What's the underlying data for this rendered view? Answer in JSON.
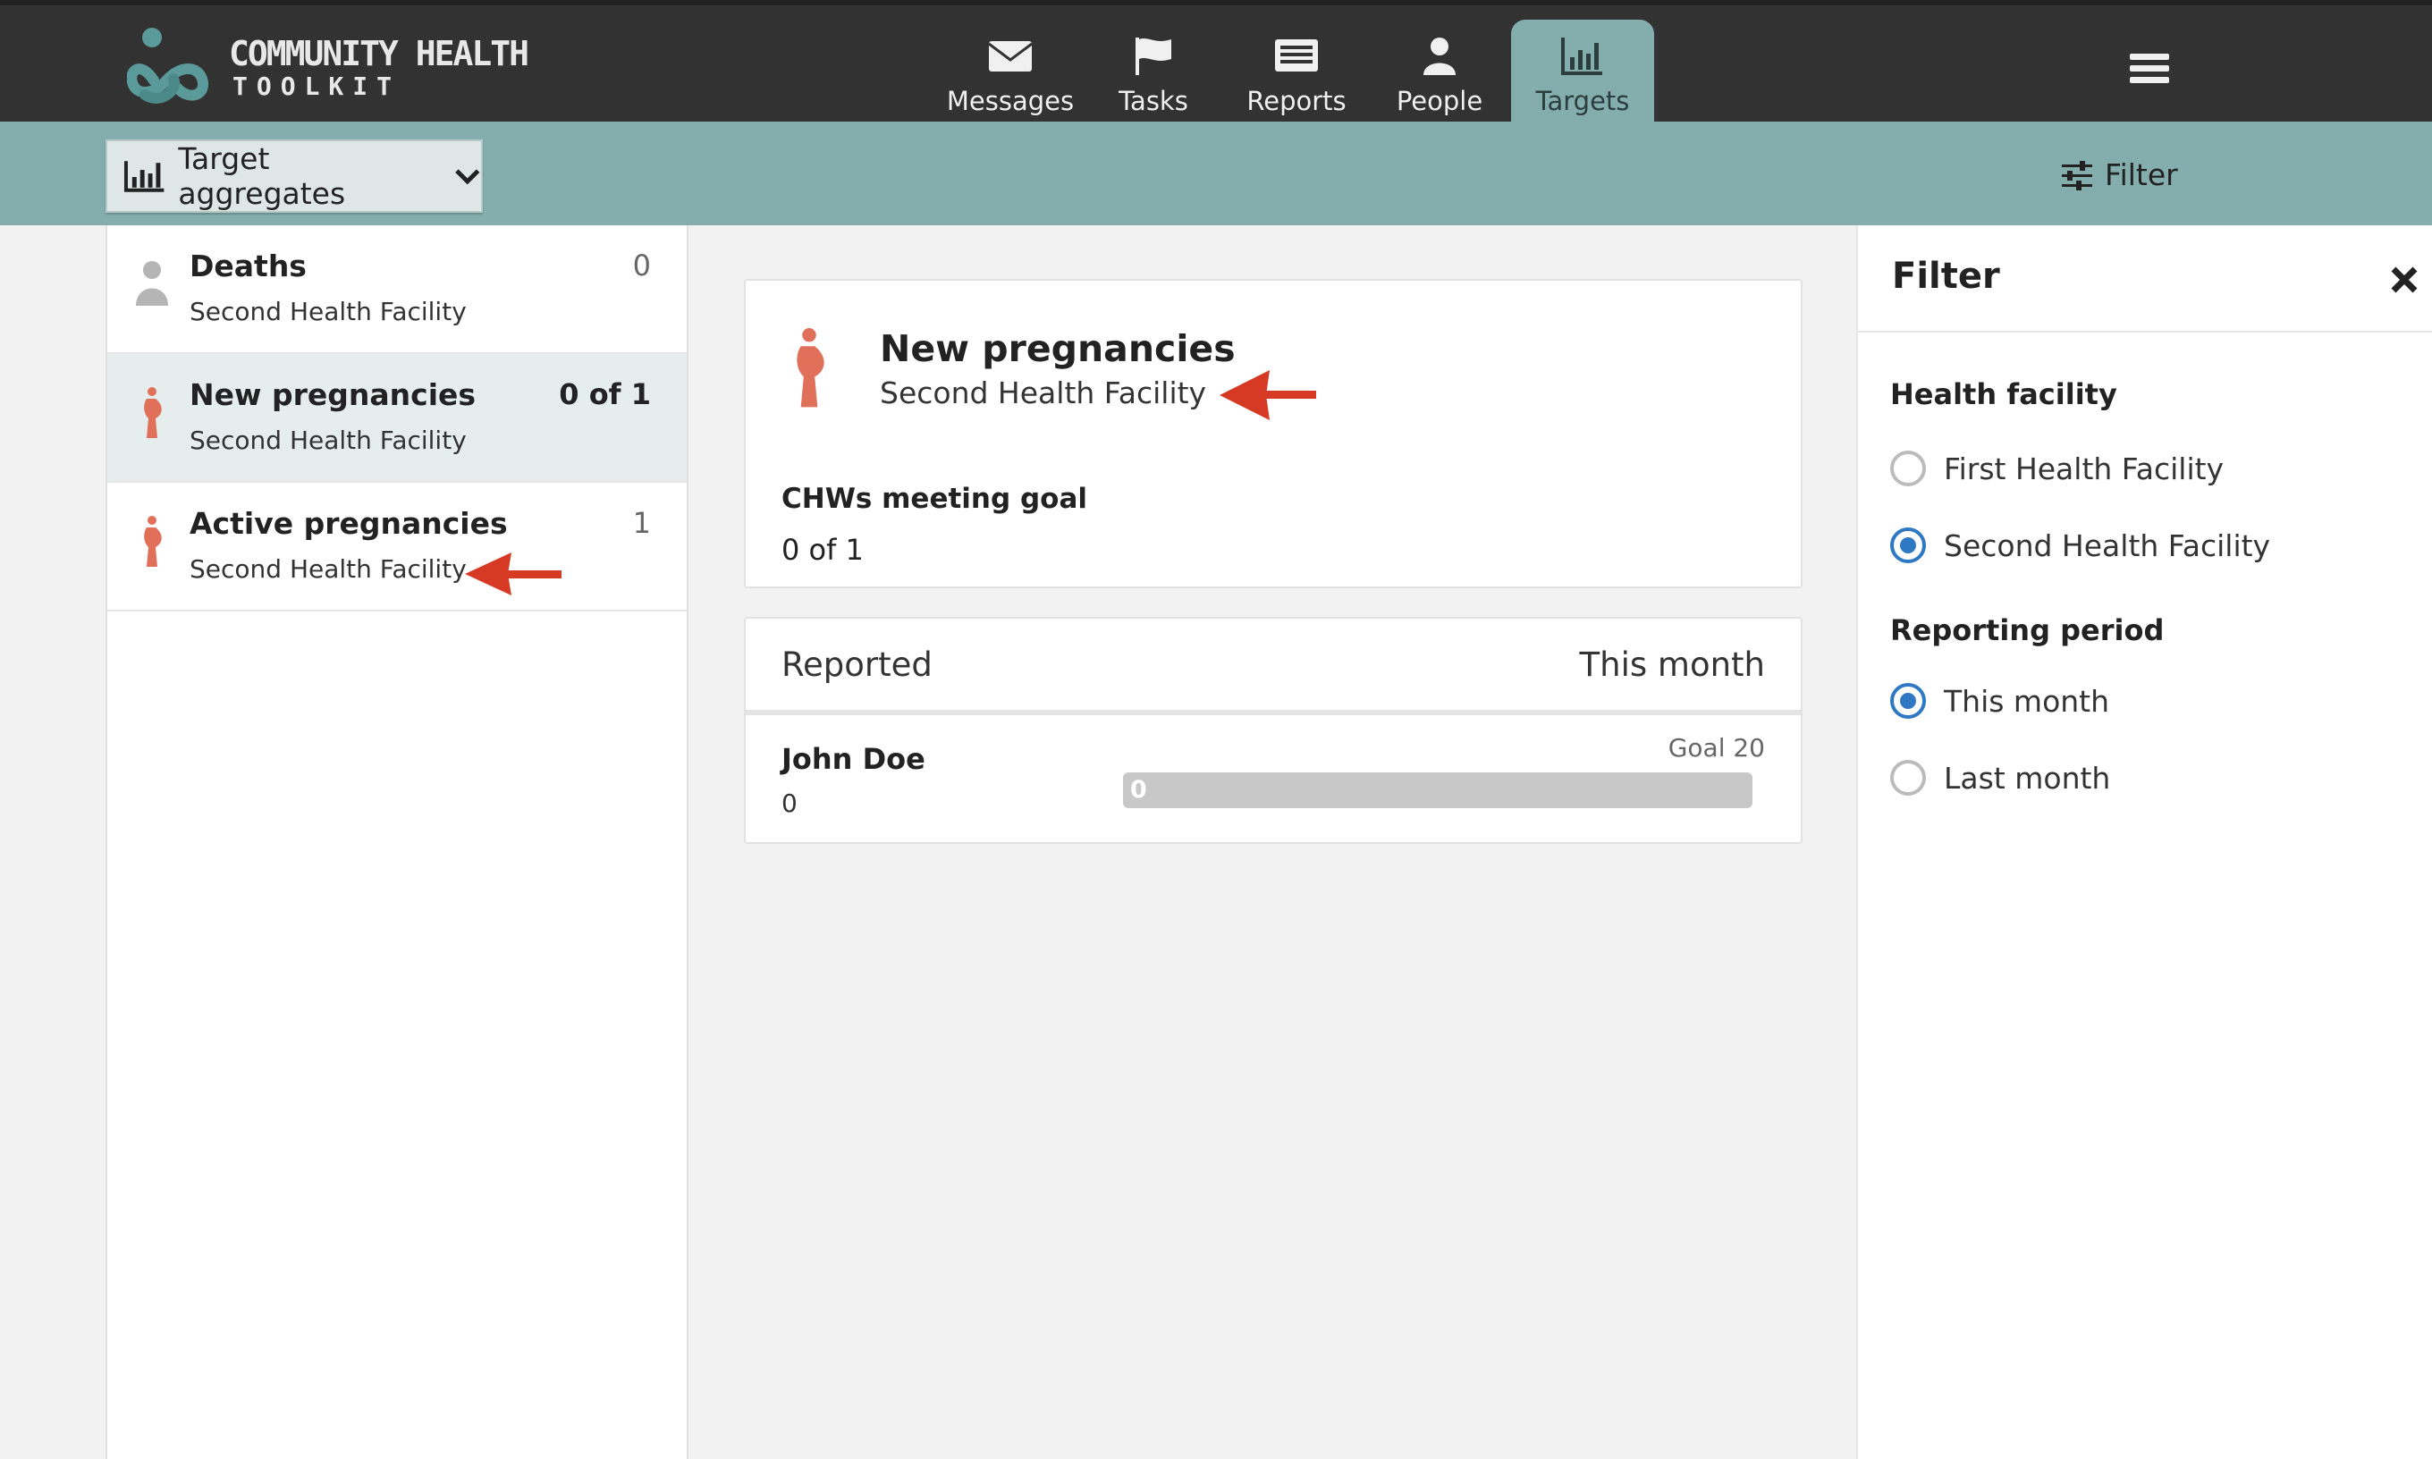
{
  "app": {
    "logo_line1": "COMMUNITY HEALTH",
    "logo_line2": "TOOLKIT"
  },
  "nav": {
    "items": [
      {
        "label": "Messages",
        "icon": "envelope-icon"
      },
      {
        "label": "Tasks",
        "icon": "flag-icon"
      },
      {
        "label": "Reports",
        "icon": "list-icon"
      },
      {
        "label": "People",
        "icon": "person-icon"
      },
      {
        "label": "Targets",
        "icon": "bar-chart-icon",
        "active": true
      }
    ]
  },
  "toolbar": {
    "aggregates_label": "Target aggregates",
    "filter_label": "Filter"
  },
  "targets_list": [
    {
      "title": "Deaths",
      "facility": "Second Health Facility",
      "count": "0",
      "icon": "person-icon"
    },
    {
      "title": "New pregnancies",
      "facility": "Second Health Facility",
      "count": "0 of 1",
      "icon": "pregnancy-icon",
      "selected": true
    },
    {
      "title": "Active pregnancies",
      "facility": "Second Health Facility",
      "count": "1",
      "icon": "pregnancy-icon"
    }
  ],
  "detail": {
    "title": "New pregnancies",
    "facility": "Second Health Facility",
    "goal_label": "CHWs meeting goal",
    "goal_value": "0 of 1",
    "table_header_left": "Reported",
    "table_header_right": "This month",
    "rows": [
      {
        "name": "John Doe",
        "value": "0",
        "goal": "Goal 20",
        "progress_label": "0",
        "progress": 0
      }
    ]
  },
  "filter_panel": {
    "title": "Filter",
    "facility_label": "Health facility",
    "facilities": [
      {
        "label": "First Health Facility",
        "selected": false
      },
      {
        "label": "Second Health Facility",
        "selected": true
      }
    ],
    "period_label": "Reporting period",
    "periods": [
      {
        "label": "This month",
        "selected": true
      },
      {
        "label": "Last month",
        "selected": false
      }
    ]
  },
  "colors": {
    "header_bg": "#323232",
    "toolbar_bg": "#84aeae",
    "pregnancy_icon": "#e0705a",
    "radio_selected": "#2f78c4",
    "annotation_arrow": "#d63a24"
  }
}
